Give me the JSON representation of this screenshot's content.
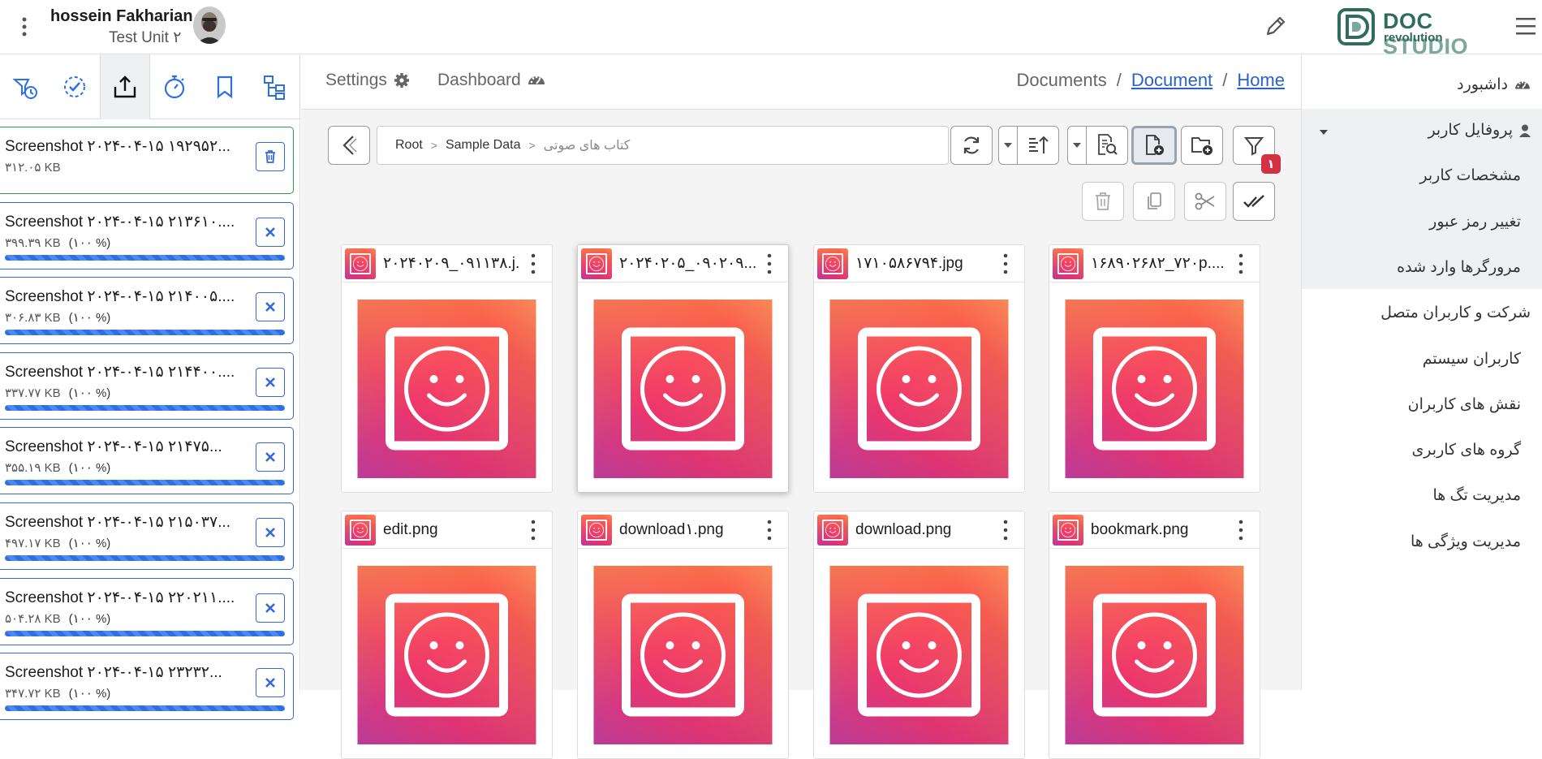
{
  "header": {
    "user_name": "hossein Fakharian",
    "user_unit": "Test Unit ۲",
    "logo_doc": "DOC",
    "logo_studio": "STUDIO",
    "logo_sub": "revolution",
    "brand_color": "#2f6c5c"
  },
  "left_panel": {
    "tabs": [
      "history-icon",
      "check-circle-icon",
      "upload-icon",
      "stopwatch-icon",
      "bookmark-icon",
      "tree-icon"
    ],
    "active_tab": "upload-icon",
    "uploads": [
      {
        "name": "Screenshot ۲۰۲۴-۰۴-۱۵ ۱۹۲۹۵۲...",
        "size": "۳۱۲.۰۵ KB",
        "percent": "",
        "progress": 0,
        "status": "done",
        "action_icon": "trash-icon"
      },
      {
        "name": "Screenshot ۲۰۲۴-۰۴-۱۵ ۲۱۳۶۱۰....",
        "size": "۳۹۹.۳۹ KB",
        "percent": "(۱۰۰ %)",
        "progress": 100,
        "status": "uploading",
        "action_icon": "close-icon"
      },
      {
        "name": "Screenshot ۲۰۲۴-۰۴-۱۵ ۲۱۴۰۰۵....",
        "size": "۳۰۶.۸۳ KB",
        "percent": "(۱۰۰ %)",
        "progress": 100,
        "status": "uploading",
        "action_icon": "close-icon"
      },
      {
        "name": "Screenshot ۲۰۲۴-۰۴-۱۵ ۲۱۴۴۰۰....",
        "size": "۳۳۷.۷۷ KB",
        "percent": "(۱۰۰ %)",
        "progress": 100,
        "status": "uploading",
        "action_icon": "close-icon"
      },
      {
        "name": "Screenshot ۲۰۲۴-۰۴-۱۵ ۲۱۴۷۵...",
        "size": "۳۵۵.۱۹ KB",
        "percent": "(۱۰۰ %)",
        "progress": 100,
        "status": "uploading",
        "action_icon": "close-icon"
      },
      {
        "name": "Screenshot ۲۰۲۴-۰۴-۱۵ ۲۱۵۰۳۷...",
        "size": "۴۹۷.۱۷ KB",
        "percent": "(۱۰۰ %)",
        "progress": 100,
        "status": "uploading",
        "action_icon": "close-icon"
      },
      {
        "name": "Screenshot ۲۰۲۴-۰۴-۱۵ ۲۲۰۲۱۱....",
        "size": "۵۰۴.۲۸ KB",
        "percent": "(۱۰۰ %)",
        "progress": 100,
        "status": "uploading",
        "action_icon": "close-icon"
      },
      {
        "name": "Screenshot ۲۰۲۴-۰۴-۱۵ ۲۳۲۳۲...",
        "size": "۳۴۷.۷۲ KB",
        "percent": "(۱۰۰ %)",
        "progress": 100,
        "status": "uploading",
        "action_icon": "close-icon"
      }
    ]
  },
  "main": {
    "tabs": {
      "settings": "Settings",
      "dashboard": "Dashboard"
    },
    "breadcrumb": {
      "documents": "Documents",
      "document": "Document",
      "home": "Home",
      "sep": "/"
    },
    "path": {
      "root": "Root",
      "sample": "Sample Data",
      "current": "کتاب های صوتی"
    },
    "filter_badge": "۱",
    "files": [
      {
        "name": "۲۰۲۴۰۲۰۹_۰۹۱۱۳۸.j..."
      },
      {
        "name": "۲۰۲۴۰۲۰۵_۰۹۰۲۰۹...."
      },
      {
        "name": "۱۷۱۰۵۸۶۷۹۴.jpg"
      },
      {
        "name": "۱۶۸۹۰۲۶۸۲_۷۲۰p...."
      },
      {
        "name": "edit.png"
      },
      {
        "name": "download۱.png"
      },
      {
        "name": "download.png"
      },
      {
        "name": "bookmark.png"
      }
    ]
  },
  "sidebar": {
    "dashboard": "داشبورد",
    "profile": "پروفایل کاربر",
    "items": [
      "مشخصات کاربر",
      "تغییر رمز عبور",
      "مرورگرها وارد شده",
      "شرکت و کاربران متصل",
      "کاربران سیستم",
      "نقش های کاربران",
      "گروه های کاربری",
      "مدیریت تگ ها",
      "مدیریت ویژگی ها"
    ]
  }
}
